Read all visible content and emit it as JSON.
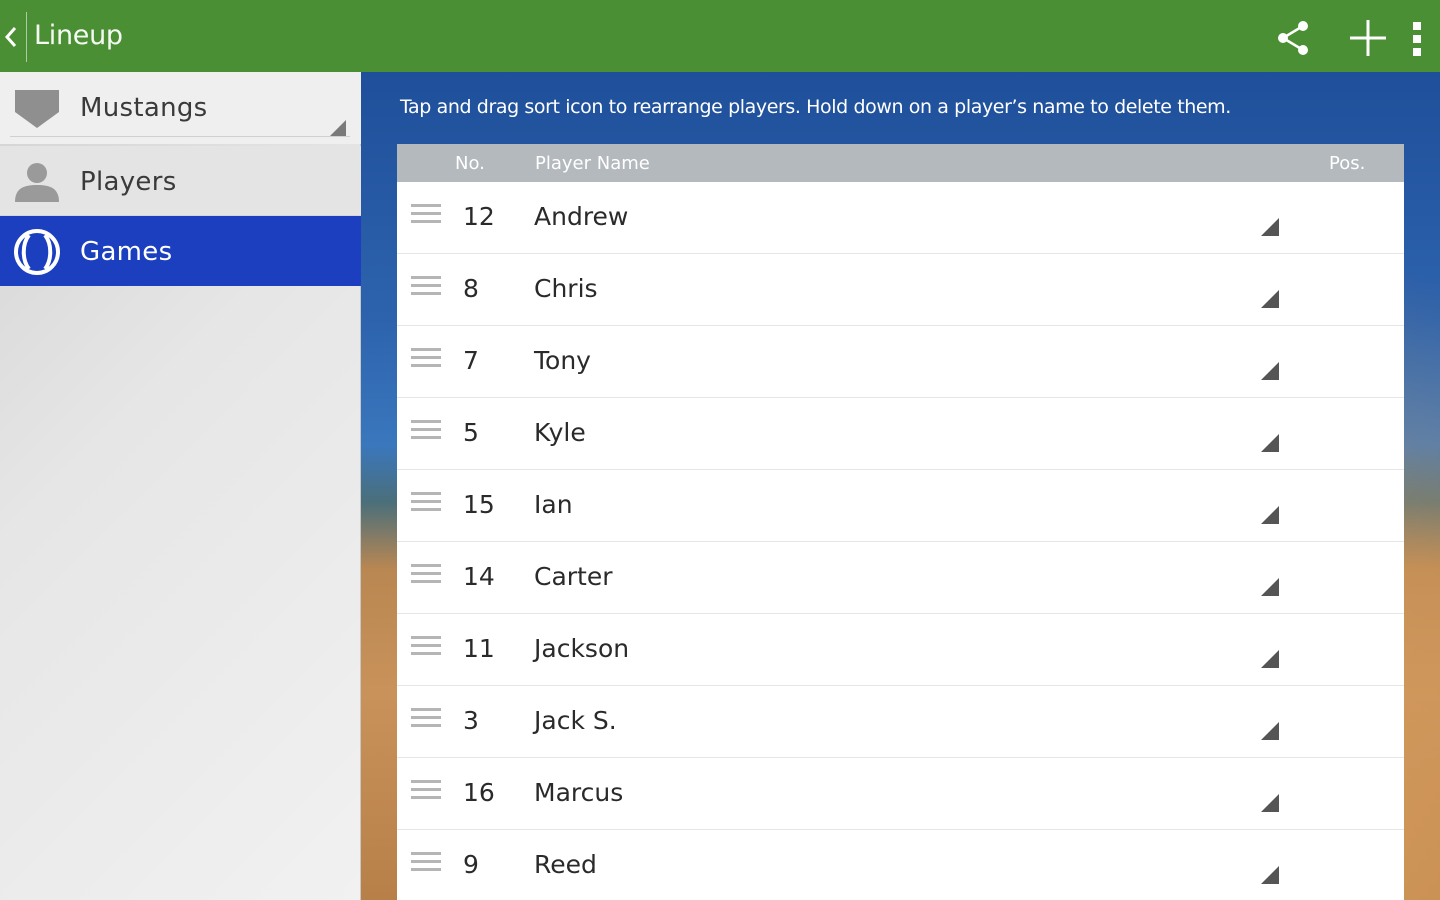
{
  "action_bar": {
    "title": "Lineup",
    "icons": [
      "back-chevron-icon",
      "share-icon",
      "add-icon",
      "overflow-menu-icon"
    ],
    "background": "#4a8f33"
  },
  "drawer": {
    "team": "Mustangs",
    "items": [
      {
        "label": "Players",
        "icon": "person-icon"
      },
      {
        "label": "Games",
        "icon": "baseball-icon",
        "selected": true
      }
    ],
    "selected_color": "#1b3fbf"
  },
  "content": {
    "instructions": "Tap and drag sort icon to rearrange players. Hold down on a player’s name to delete them.",
    "columns": {
      "no": "No.",
      "name": "Player Name",
      "pos": "Pos."
    },
    "rows": [
      {
        "no": "12",
        "name": "Andrew"
      },
      {
        "no": "8",
        "name": "Chris"
      },
      {
        "no": "7",
        "name": "Tony"
      },
      {
        "no": "5",
        "name": "Kyle"
      },
      {
        "no": "15",
        "name": "Ian"
      },
      {
        "no": "14",
        "name": "Carter"
      },
      {
        "no": "11",
        "name": "Jackson"
      },
      {
        "no": "3",
        "name": "Jack S."
      },
      {
        "no": "16",
        "name": "Marcus"
      },
      {
        "no": "9",
        "name": "Reed"
      }
    ]
  }
}
